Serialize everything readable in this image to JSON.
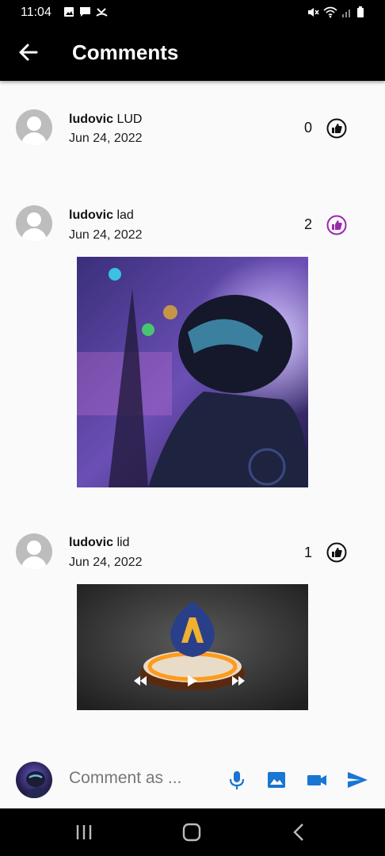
{
  "status": {
    "time": "11:04"
  },
  "appbar": {
    "title": "Comments"
  },
  "comments": [
    {
      "author": "ludovic",
      "text": "LUD",
      "date": "Jun 24, 2022",
      "likes": "0",
      "liked": false
    },
    {
      "author": "ludovic",
      "text": "lad",
      "date": "Jun 24, 2022",
      "likes": "2",
      "liked": true
    },
    {
      "author": "ludovic",
      "text": "lid",
      "date": "Jun 24, 2022",
      "likes": "1",
      "liked": false
    }
  ],
  "composer": {
    "placeholder": "Comment as ..."
  },
  "colors": {
    "accent": "#1976d2",
    "liked": "#9c27b0",
    "bar": "#000000"
  }
}
